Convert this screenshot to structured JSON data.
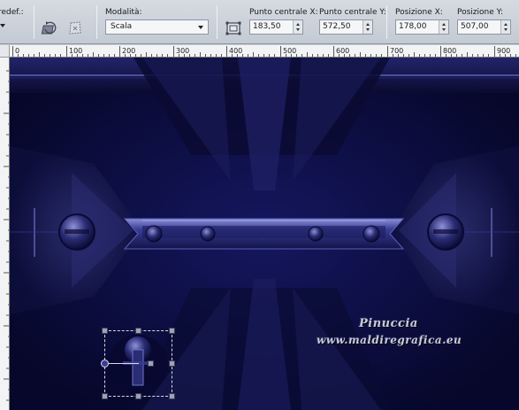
{
  "toolbar": {
    "preset_label": "redef.:",
    "mode_label": "Modalità:",
    "mode_value": "Scala",
    "center_x_label": "Punto centrale X:",
    "center_x_value": "183,50",
    "center_y_label": "Punto centrale Y:",
    "center_y_value": "572,50",
    "pos_x_label": "Posizione X:",
    "pos_x_value": "178,00",
    "pos_y_label": "Posizione Y:",
    "pos_y_value": "507,00"
  },
  "ruler": {
    "labels": [
      "0",
      "100",
      "200",
      "300",
      "400",
      "500",
      "600",
      "700",
      "800",
      "900"
    ]
  },
  "canvas": {
    "signature_name": "Pinuccia",
    "signature_url": "www.maldiregrafica.eu",
    "colors": {
      "background": "#0c0d3a",
      "frame": "#25276a",
      "highlight": "#6d72c4"
    }
  }
}
